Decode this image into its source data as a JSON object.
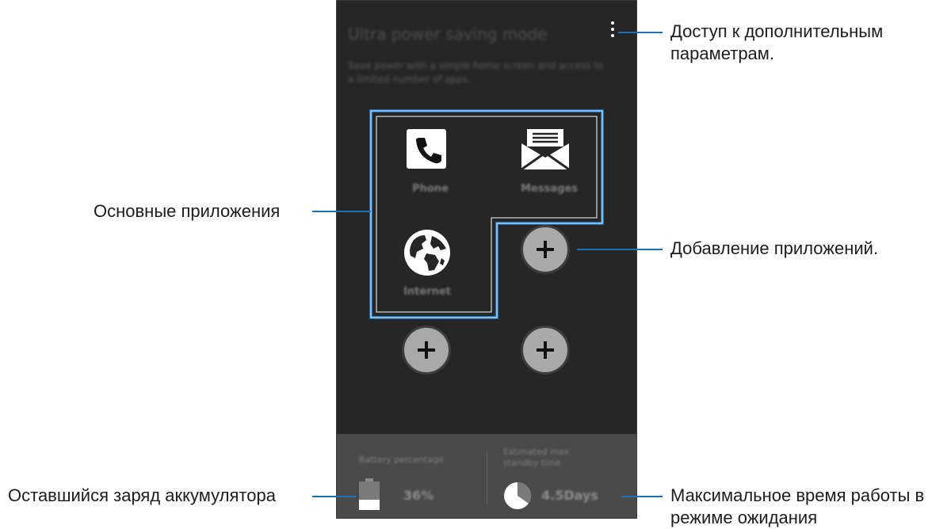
{
  "screen": {
    "title": "Ultra power saving mode",
    "description": "Save power with a simple home screen and access to a limited number of apps.",
    "menu_icon": "more-vertical-icon"
  },
  "apps": [
    {
      "label": "Phone",
      "icon": "phone-icon"
    },
    {
      "label": "Messages",
      "icon": "envelope-icon"
    },
    {
      "label": "Internet",
      "icon": "globe-icon"
    }
  ],
  "add_buttons": {
    "icon": "plus-icon",
    "count": 3
  },
  "status": {
    "battery_label": "Battery percentage",
    "battery_value": "36%",
    "battery_level": 0.36,
    "standby_label": "Estimated max. standby time",
    "standby_value": "4.5Days"
  },
  "callouts": {
    "more_options": "Доступ к дополнительным параметрам.",
    "main_apps": "Основные приложения",
    "add_apps": "Добавление приложений.",
    "battery_left": "Оставшийся заряд аккумулятора",
    "max_standby": "Максимальное время работы в режиме ожидания"
  },
  "colors": {
    "background": "#262626",
    "highlight": "#1b71b8",
    "status_bar": "#4a4a4a",
    "add_button": "#a9a9a9"
  }
}
